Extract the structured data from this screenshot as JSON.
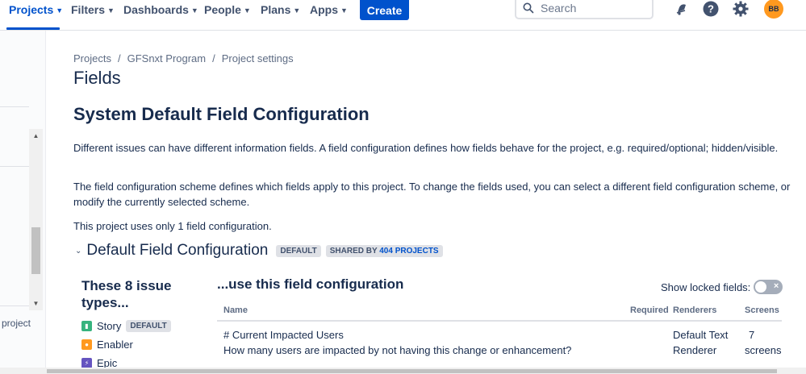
{
  "nav": {
    "items": [
      {
        "label": "Projects"
      },
      {
        "label": "Filters"
      },
      {
        "label": "Dashboards"
      },
      {
        "label": "People"
      },
      {
        "label": "Plans"
      },
      {
        "label": "Apps"
      }
    ],
    "create_label": "Create",
    "search_placeholder": "Search",
    "avatar_initials": "BB",
    "accent_color": "#0052cc",
    "avatar_color": "#ff991f"
  },
  "sidebar": {
    "partial_text": "project"
  },
  "breadcrumb": [
    "Projects",
    "GFSnxt Program",
    "Project settings"
  ],
  "page_title": "Fields",
  "config_title": "System Default Field Configuration",
  "paragraphs": [
    "Different issues can have different information fields. A field configuration defines how fields behave for the project, e.g. required/optional; hidden/visible.",
    "The field configuration scheme defines which fields apply to this project. To change the fields used, you can select a different field configuration scheme, or modify the currently selected scheme.",
    "This project uses only 1 field configuration."
  ],
  "field_config": {
    "name": "Default Field Configuration",
    "default_badge": "DEFAULT",
    "shared_prefix": "SHARED BY",
    "shared_count": "404",
    "shared_suffix": "PROJECTS"
  },
  "issue_types": {
    "heading": "These 8 issue types...",
    "items": [
      {
        "label": "Story",
        "badge": "DEFAULT",
        "icon": "story-icon"
      },
      {
        "label": "Enabler",
        "icon": "enabler-icon"
      },
      {
        "label": "Epic",
        "icon": "epic-icon"
      }
    ]
  },
  "fields_table": {
    "heading": "...use this field configuration",
    "show_locked_label": "Show locked fields:",
    "columns": [
      "Name",
      "Required",
      "Renderers",
      "Screens"
    ],
    "rows": [
      {
        "name": "# Current Impacted Users",
        "description": "How many users are impacted by not having this change or enhancement?",
        "renderer_line1": "Default Text",
        "renderer_line2": "Renderer",
        "screens_line1": "7",
        "screens_line2": "screens"
      }
    ]
  }
}
